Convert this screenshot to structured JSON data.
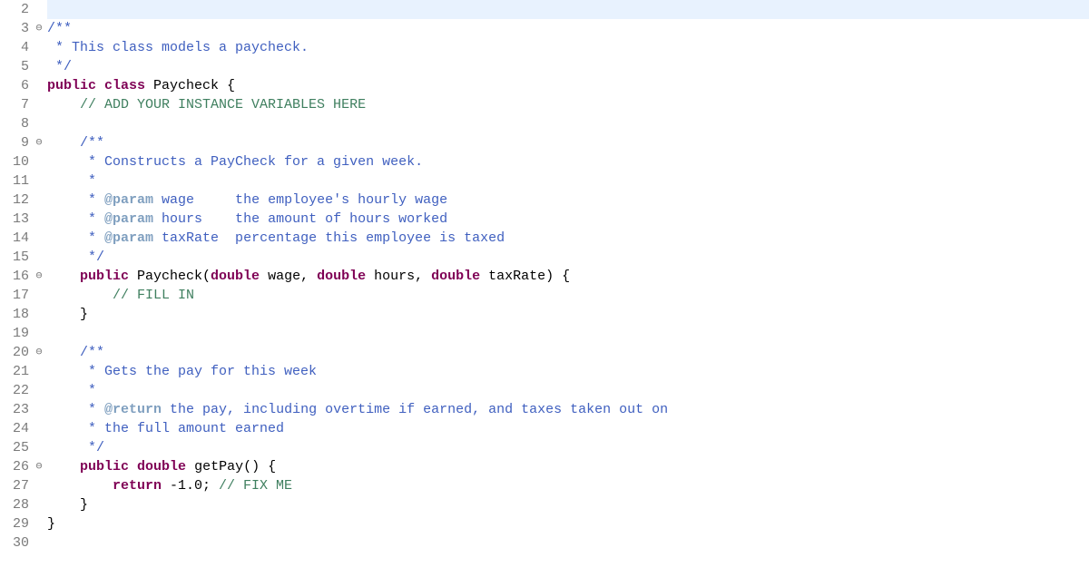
{
  "lines": [
    {
      "num": "2",
      "fold": "",
      "hl": true,
      "tokens": []
    },
    {
      "num": "3",
      "fold": "⊖",
      "tokens": [
        {
          "cls": "c-doc",
          "t": "/**"
        }
      ]
    },
    {
      "num": "4",
      "fold": "",
      "tokens": [
        {
          "cls": "c-doc",
          "t": " * This class models a paycheck."
        }
      ]
    },
    {
      "num": "5",
      "fold": "",
      "tokens": [
        {
          "cls": "c-doc",
          "t": " */"
        }
      ]
    },
    {
      "num": "6",
      "fold": "",
      "tokens": [
        {
          "cls": "c-kw",
          "t": "public"
        },
        {
          "cls": "c-id",
          "t": " "
        },
        {
          "cls": "c-kw",
          "t": "class"
        },
        {
          "cls": "c-id",
          "t": " Paycheck {"
        }
      ]
    },
    {
      "num": "7",
      "fold": "",
      "tokens": [
        {
          "cls": "c-id",
          "t": "    "
        },
        {
          "cls": "c-comment",
          "t": "// ADD YOUR INSTANCE VARIABLES HERE"
        }
      ]
    },
    {
      "num": "8",
      "fold": "",
      "tokens": []
    },
    {
      "num": "9",
      "fold": "⊖",
      "tokens": [
        {
          "cls": "c-id",
          "t": "    "
        },
        {
          "cls": "c-doc",
          "t": "/**"
        }
      ]
    },
    {
      "num": "10",
      "fold": "",
      "tokens": [
        {
          "cls": "c-id",
          "t": "    "
        },
        {
          "cls": "c-doc",
          "t": " * Constructs a PayCheck for a given week."
        }
      ]
    },
    {
      "num": "11",
      "fold": "",
      "tokens": [
        {
          "cls": "c-id",
          "t": "    "
        },
        {
          "cls": "c-doc",
          "t": " *"
        }
      ]
    },
    {
      "num": "12",
      "fold": "",
      "tokens": [
        {
          "cls": "c-id",
          "t": "    "
        },
        {
          "cls": "c-doc",
          "t": " * "
        },
        {
          "cls": "c-doctag",
          "t": "@param"
        },
        {
          "cls": "c-doc",
          "t": " wage     the employee's hourly wage"
        }
      ]
    },
    {
      "num": "13",
      "fold": "",
      "tokens": [
        {
          "cls": "c-id",
          "t": "    "
        },
        {
          "cls": "c-doc",
          "t": " * "
        },
        {
          "cls": "c-doctag",
          "t": "@param"
        },
        {
          "cls": "c-doc",
          "t": " hours    the amount of hours worked"
        }
      ]
    },
    {
      "num": "14",
      "fold": "",
      "tokens": [
        {
          "cls": "c-id",
          "t": "    "
        },
        {
          "cls": "c-doc",
          "t": " * "
        },
        {
          "cls": "c-doctag",
          "t": "@param"
        },
        {
          "cls": "c-doc",
          "t": " taxRate  percentage this employee is taxed"
        }
      ]
    },
    {
      "num": "15",
      "fold": "",
      "tokens": [
        {
          "cls": "c-id",
          "t": "    "
        },
        {
          "cls": "c-doc",
          "t": " */"
        }
      ]
    },
    {
      "num": "16",
      "fold": "⊖",
      "tokens": [
        {
          "cls": "c-id",
          "t": "    "
        },
        {
          "cls": "c-kw",
          "t": "public"
        },
        {
          "cls": "c-id",
          "t": " Paycheck("
        },
        {
          "cls": "c-kw",
          "t": "double"
        },
        {
          "cls": "c-id",
          "t": " wage, "
        },
        {
          "cls": "c-kw",
          "t": "double"
        },
        {
          "cls": "c-id",
          "t": " hours, "
        },
        {
          "cls": "c-kw",
          "t": "double"
        },
        {
          "cls": "c-id",
          "t": " taxRate) {"
        }
      ]
    },
    {
      "num": "17",
      "fold": "",
      "tokens": [
        {
          "cls": "c-id",
          "t": "        "
        },
        {
          "cls": "c-comment",
          "t": "// FILL IN"
        }
      ]
    },
    {
      "num": "18",
      "fold": "",
      "tokens": [
        {
          "cls": "c-id",
          "t": "    }"
        }
      ]
    },
    {
      "num": "19",
      "fold": "",
      "tokens": []
    },
    {
      "num": "20",
      "fold": "⊖",
      "tokens": [
        {
          "cls": "c-id",
          "t": "    "
        },
        {
          "cls": "c-doc",
          "t": "/**"
        }
      ]
    },
    {
      "num": "21",
      "fold": "",
      "tokens": [
        {
          "cls": "c-id",
          "t": "    "
        },
        {
          "cls": "c-doc",
          "t": " * Gets the pay for this week"
        }
      ]
    },
    {
      "num": "22",
      "fold": "",
      "tokens": [
        {
          "cls": "c-id",
          "t": "    "
        },
        {
          "cls": "c-doc",
          "t": " *"
        }
      ]
    },
    {
      "num": "23",
      "fold": "",
      "tokens": [
        {
          "cls": "c-id",
          "t": "    "
        },
        {
          "cls": "c-doc",
          "t": " * "
        },
        {
          "cls": "c-doctag",
          "t": "@return"
        },
        {
          "cls": "c-doc",
          "t": " the pay, including overtime if earned, and taxes taken out on"
        }
      ]
    },
    {
      "num": "24",
      "fold": "",
      "tokens": [
        {
          "cls": "c-id",
          "t": "    "
        },
        {
          "cls": "c-doc",
          "t": " * the full amount earned"
        }
      ]
    },
    {
      "num": "25",
      "fold": "",
      "tokens": [
        {
          "cls": "c-id",
          "t": "    "
        },
        {
          "cls": "c-doc",
          "t": " */"
        }
      ]
    },
    {
      "num": "26",
      "fold": "⊖",
      "tokens": [
        {
          "cls": "c-id",
          "t": "    "
        },
        {
          "cls": "c-kw",
          "t": "public"
        },
        {
          "cls": "c-id",
          "t": " "
        },
        {
          "cls": "c-kw",
          "t": "double"
        },
        {
          "cls": "c-id",
          "t": " getPay() {"
        }
      ]
    },
    {
      "num": "27",
      "fold": "",
      "tokens": [
        {
          "cls": "c-id",
          "t": "        "
        },
        {
          "cls": "c-kw",
          "t": "return"
        },
        {
          "cls": "c-id",
          "t": " -1.0; "
        },
        {
          "cls": "c-comment",
          "t": "// FIX ME"
        }
      ]
    },
    {
      "num": "28",
      "fold": "",
      "tokens": [
        {
          "cls": "c-id",
          "t": "    }"
        }
      ]
    },
    {
      "num": "29",
      "fold": "",
      "tokens": [
        {
          "cls": "c-id",
          "t": "}"
        }
      ]
    },
    {
      "num": "30",
      "fold": "",
      "tokens": []
    }
  ]
}
